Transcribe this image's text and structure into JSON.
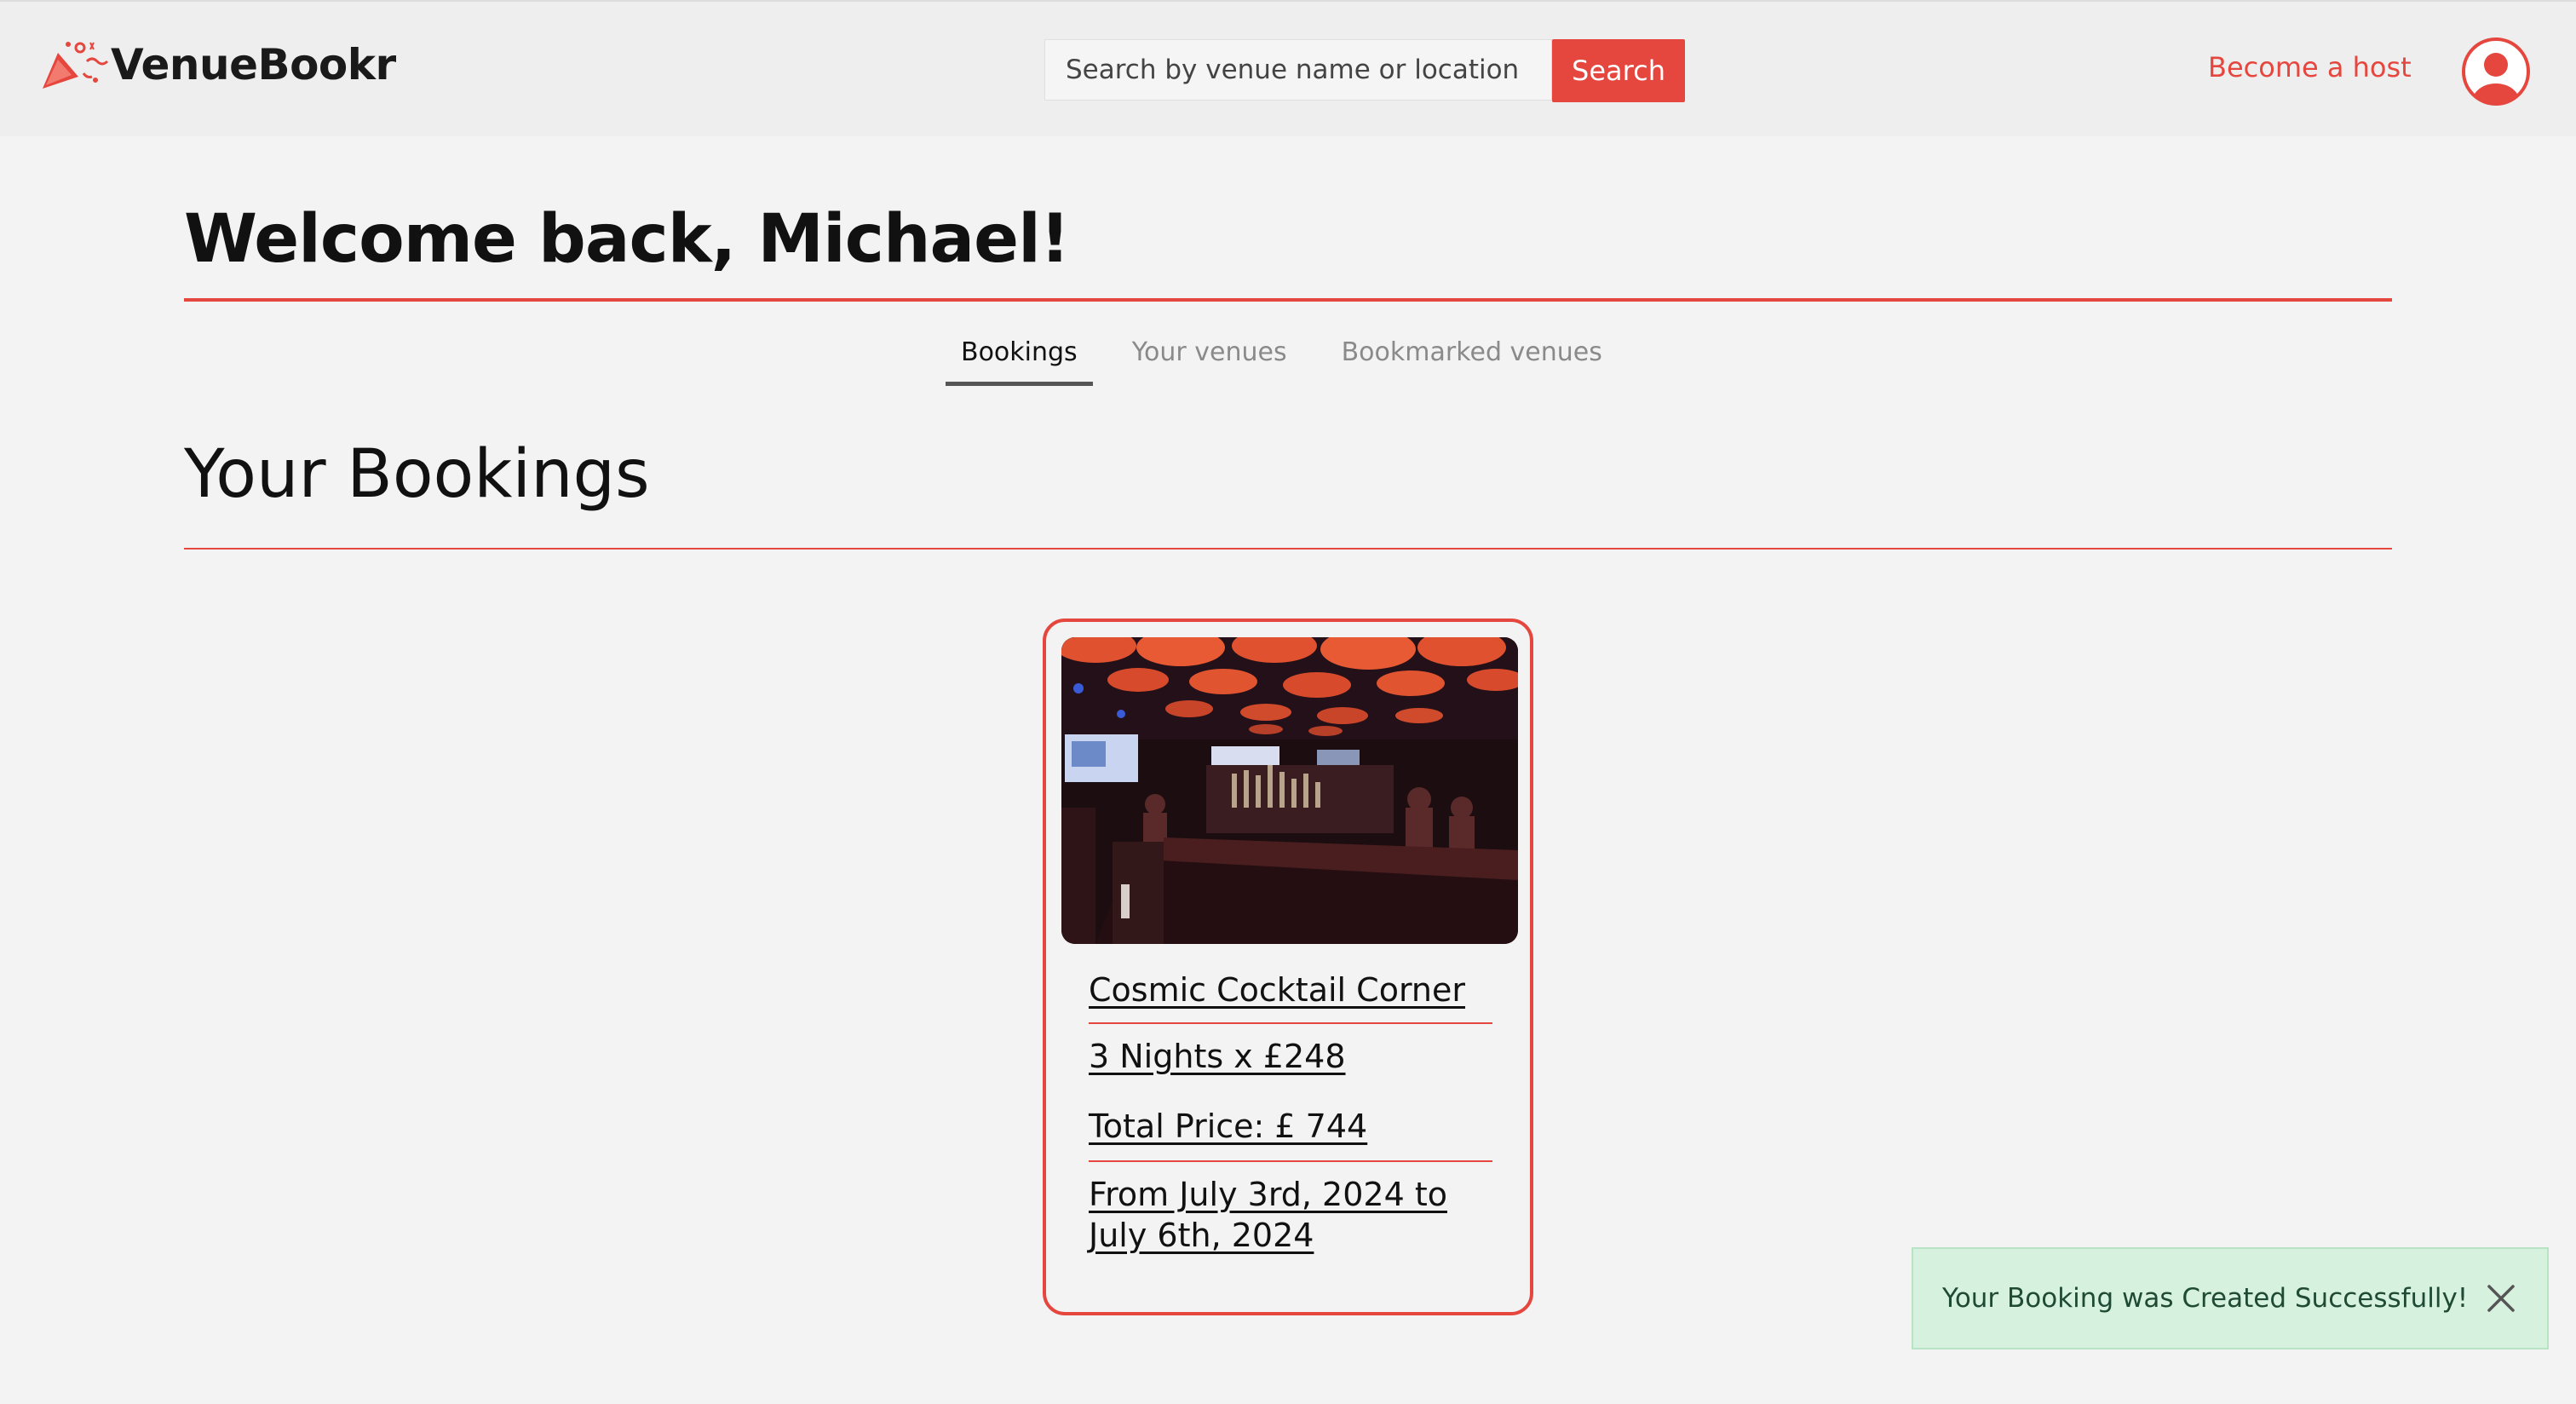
{
  "header": {
    "logo_text": "VenueBookr",
    "search_placeholder": "Search by venue name or location",
    "search_button": "Search",
    "become_host": "Become a host"
  },
  "welcome": "Welcome back, Michael!",
  "tabs": [
    {
      "label": "Bookings",
      "active": true
    },
    {
      "label": "Your venues",
      "active": false
    },
    {
      "label": "Bookmarked venues",
      "active": false
    }
  ],
  "section_title": "Your Bookings",
  "booking": {
    "venue_name": "Cosmic Cocktail Corner",
    "nights_line": "3 Nights x £248",
    "total_line": "Total Price: £ 744",
    "dates_line1": "From July 3rd, 2024 to",
    "dates_line2": "July 6th, 2024"
  },
  "toast": {
    "message": "Your Booking was Created Successfully!"
  },
  "colors": {
    "accent": "#e5463d",
    "toast_bg": "#d6f2df",
    "toast_text": "#1f4a33",
    "page_bg": "#f3f3f3"
  },
  "icons": {
    "logo": "party-popper-icon",
    "avatar": "user-circle-icon",
    "close": "close-icon"
  }
}
